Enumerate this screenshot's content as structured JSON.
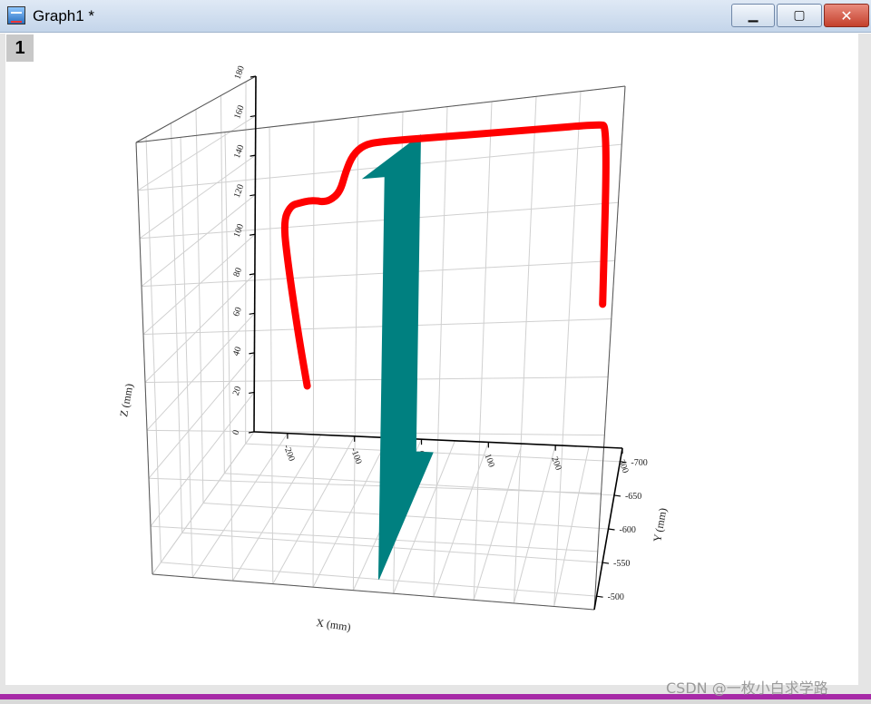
{
  "window": {
    "title": "Graph1 *",
    "layer_badge": "1",
    "buttons": {
      "minimize": "▁",
      "maximize": "▢",
      "close": "✕"
    }
  },
  "watermark": "CSDN @一枚小白求学路",
  "chart_data": {
    "type": "line",
    "three_d": true,
    "grid": true,
    "axes": {
      "x": {
        "label": "X  (mm)",
        "range": [
          -250,
          300
        ],
        "ticks": [
          "-200",
          "-100",
          "0",
          "100",
          "200",
          "300"
        ]
      },
      "y": {
        "label": "Y (mm)",
        "range": [
          -720,
          -480
        ],
        "ticks": [
          "-500",
          "-550",
          "-600",
          "-650",
          "-700"
        ]
      },
      "z": {
        "label": "Z (mm)",
        "range": [
          0,
          180
        ],
        "ticks": [
          "0",
          "20",
          "40",
          "60",
          "80",
          "100",
          "120",
          "140",
          "160",
          "180"
        ]
      }
    },
    "series": [
      {
        "color": "#ff0000",
        "x": [
          -160,
          -162,
          -160,
          -150,
          -130,
          -110,
          -95,
          -80,
          -72,
          -60,
          -45,
          -35,
          -25,
          -10,
          10,
          100,
          200,
          270,
          280,
          285
        ],
        "y": [
          -700,
          -680,
          -650,
          -620,
          -600,
          -585,
          -575,
          -565,
          -560,
          -555,
          -548,
          -540,
          -535,
          -530,
          -528,
          -525,
          -522,
          -520,
          -525,
          -530
        ],
        "z": [
          30,
          60,
          100,
          125,
          135,
          138,
          140,
          141,
          141,
          142,
          146,
          155,
          162,
          166,
          167,
          167,
          167,
          167,
          166,
          100
        ]
      }
    ],
    "obstacle": {
      "color": "#008080",
      "x": [
        0,
        25
      ],
      "y": [
        -700,
        -500
      ],
      "z": [
        0,
        155
      ]
    }
  }
}
